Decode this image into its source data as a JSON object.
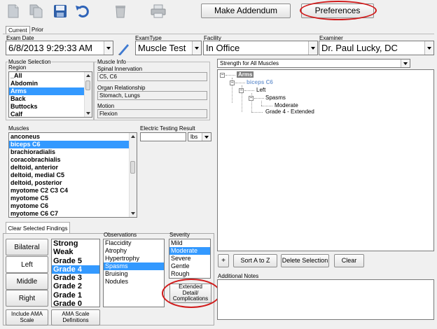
{
  "toolbar": {
    "make_addendum": "Make Addendum",
    "preferences": "Preferences"
  },
  "tabs": [
    "Current",
    "Prior"
  ],
  "header": {
    "exam_date_label": "Exam Date",
    "exam_date_value": "6/8/2013 9:29:33 AM",
    "exam_type_label": "ExamType",
    "exam_type_value": "Muscle Test",
    "facility_label": "Facility",
    "facility_value": "In Office",
    "examiner_label": "Examiner",
    "examiner_value": "Dr. Paul Lucky, DC"
  },
  "muscle_selection": {
    "title": "Muscle Selection",
    "region_label": "Region",
    "regions": [
      "_All",
      "Abdomin",
      "Arms",
      "Back",
      "Buttocks",
      "Calf"
    ],
    "selected_region": "Arms"
  },
  "muscle_info": {
    "title": "Muscle Info",
    "spinal_label": "Spinal Innervation",
    "spinal_value": "C5, C6",
    "organ_label": "Organ Relationship",
    "organ_value": "Stomach, Lungs",
    "motion_label": "Motion",
    "motion_value": "Flexion"
  },
  "muscles": {
    "label": "Muscles",
    "items": [
      "anconeus",
      "biceps C6",
      "brachioradialis",
      "coracobrachialis",
      "deltoid, anterior",
      "deltoid, medial C5",
      "deltoid, posterior",
      "myotome C2 C3 C4",
      "myotome C5",
      "myotome C6",
      "myotome C6 C7"
    ],
    "selected": "biceps C6"
  },
  "electric": {
    "label": "Electric Testing Result",
    "unit": "lbs"
  },
  "clear_findings": "Clear Selected Findings",
  "sides": [
    "Bilateral",
    "Left",
    "Middle",
    "Right"
  ],
  "grades": {
    "items": [
      "Strong",
      "Weak",
      "Grade 5",
      "Grade 4",
      "Grade 3",
      "Grade 2",
      "Grade 1",
      "Grade 0"
    ],
    "selected": "Grade 4"
  },
  "observations": {
    "label": "Observations",
    "items": [
      "Flaccidity",
      "Atrophy",
      "Hypertrophy",
      "Spasms",
      "Bruising",
      "Nodules"
    ],
    "selected": "Spasms"
  },
  "severity": {
    "label": "Severity",
    "items": [
      "Mild",
      "Moderate",
      "Severe",
      "Gentle",
      "Rough"
    ],
    "selected": "Moderate"
  },
  "extended_detail": "Extended Detail/ Complications",
  "include_ama": "Include AMA Scale",
  "ama_defs": "AMA Scale Definitions",
  "strength": {
    "dropdown": "Strength for All Muscles",
    "tree": {
      "root": "Arms",
      "muscle": "biceps C6",
      "side": "Left",
      "finding": "Spasms",
      "severity": "Moderate",
      "grade": "Grade 4 - Extended"
    }
  },
  "tree_buttons": {
    "plus": "+",
    "sort": "Sort A to Z",
    "delete": "Delete Selection",
    "clear": "Clear"
  },
  "notes_label": "Additional Notes",
  "colors": {
    "selection": "#3399ff",
    "highlight_oval": "#d11b1b",
    "tree_muscle": "#7a9fd4"
  }
}
